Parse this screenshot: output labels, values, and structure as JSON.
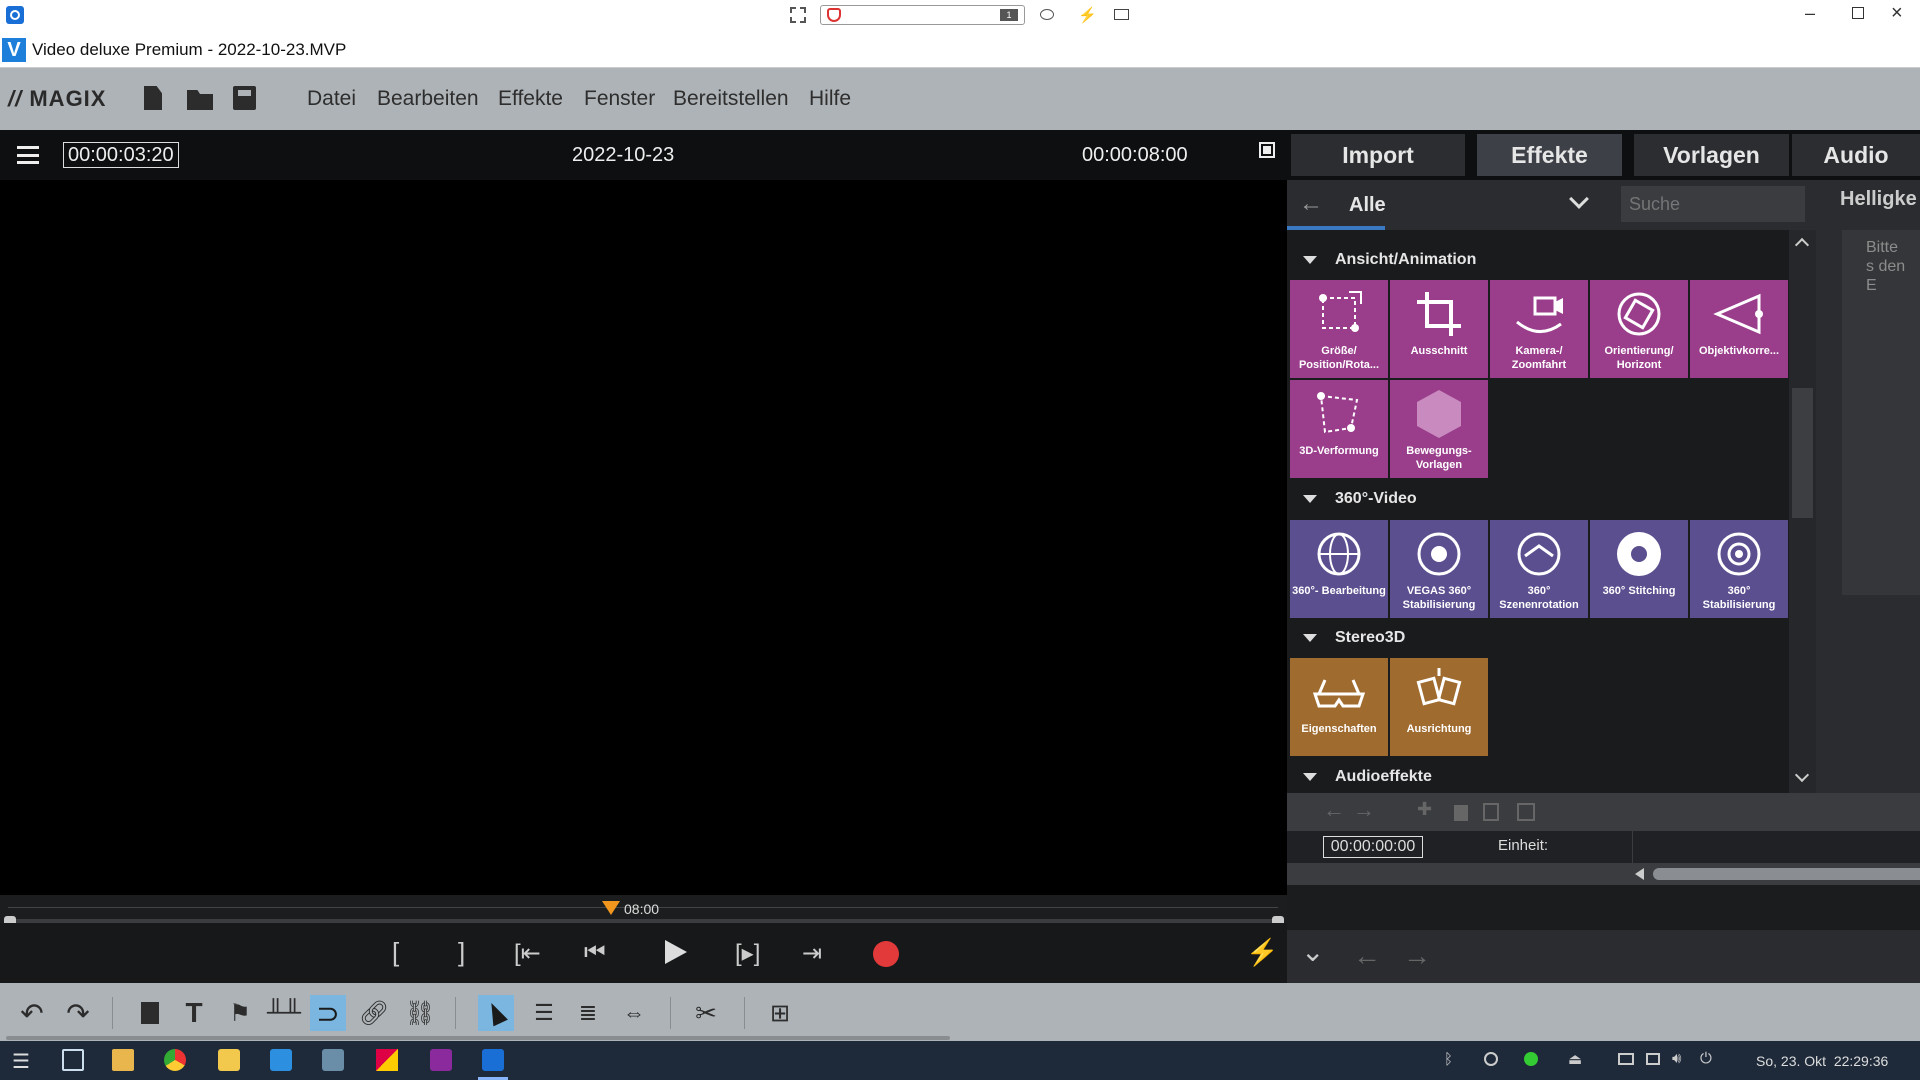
{
  "window": {
    "title": "Video deluxe Premium - 2022-10-23.MVP"
  },
  "brand": {
    "logo": "MAGIX"
  },
  "menu": {
    "items": [
      "Datei",
      "Bearbeiten",
      "Effekte",
      "Fenster",
      "Bereitstellen",
      "Hilfe"
    ]
  },
  "preview": {
    "timecode": "00:00:03:20",
    "project_name": "2022-10-23",
    "duration": "00:00:08:00",
    "marker_time": "08:00"
  },
  "tabs": [
    "Import",
    "Effekte",
    "Vorlagen",
    "Audio"
  ],
  "filter": {
    "category": "Alle",
    "search_placeholder": "Suche",
    "side_title": "Helligke",
    "side_hint": "Bitte s den E"
  },
  "sections": {
    "s1": {
      "title": "Ansicht/Animation",
      "tiles": [
        "Größe/ Position/Rota...",
        "Ausschnitt",
        "Kamera-/ Zoomfahrt",
        "Orientierung/ Horizont",
        "Objektivkorre...",
        "3D-Verformung",
        "Bewegungs- Vorlagen"
      ]
    },
    "s2": {
      "title": "360°-Video",
      "tiles": [
        "360°- Bearbeitung",
        "VEGAS 360° Stabilisierung",
        "360° Szenenrotation",
        "360° Stitching",
        "360° Stabilisierung"
      ]
    },
    "s3": {
      "title": "Stereo3D",
      "tiles": [
        "Eigenschaften",
        "Ausrichtung"
      ]
    },
    "s4": {
      "title": "Audioeffekte"
    }
  },
  "fx": {
    "time": "00:00:00:00",
    "unit_label": "Einheit:"
  },
  "taskbar": {
    "datetime": "So, 23. Okt  22:29:36"
  },
  "colors": {
    "accent_pink": "#9a3e8c",
    "accent_purple": "#5b4f8f",
    "accent_brown": "#a06b2f",
    "record": "#e23a3a",
    "marker": "#f0961e"
  }
}
